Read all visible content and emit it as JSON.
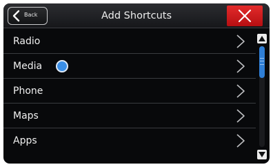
{
  "header": {
    "back_label": "Back",
    "title": "Add Shortcuts",
    "close_icon": "close-x-icon",
    "back_icon": "chevron-left-icon"
  },
  "list": {
    "items": [
      {
        "label": "Radio",
        "chevron": "chevron-right-icon"
      },
      {
        "label": "Media",
        "chevron": "chevron-right-icon",
        "indicator": "blue-dot"
      },
      {
        "label": "Phone",
        "chevron": "chevron-right-icon"
      },
      {
        "label": "Maps",
        "chevron": "chevron-right-icon"
      },
      {
        "label": "Apps",
        "chevron": "chevron-right-icon"
      }
    ]
  },
  "scrollbar": {
    "up_icon": "triangle-up-icon",
    "down_icon": "triangle-down-icon",
    "position": 0
  },
  "colors": {
    "background": "#08090b",
    "close_button": "#d41c1e",
    "accent": "#2f7fd6",
    "text": "#f0f0f0"
  }
}
